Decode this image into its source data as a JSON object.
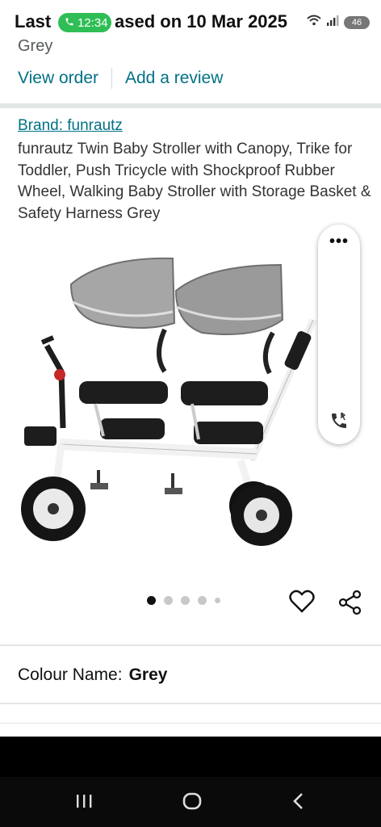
{
  "status": {
    "label_start": "Last",
    "call_time": "12:34",
    "label_end": "ased on 10 Mar 2025",
    "battery": "46"
  },
  "order": {
    "color": "Grey",
    "view_order": "View order",
    "add_review": "Add a review"
  },
  "product": {
    "brand": "Brand: funrautz",
    "title": "funrautz Twin Baby Stroller with Canopy, Trike for Toddler, Push Tricycle with Shockproof Rubber Wheel, Walking Baby Stroller with Storage Basket & Safety Harness Grey"
  },
  "carousel": {
    "total": 5,
    "active": 0
  },
  "colour": {
    "label": "Colour Name:",
    "value": "Grey"
  },
  "colors": {
    "link": "#007185",
    "canopy": "#9a9a9a",
    "frame": "#f2f2f2",
    "seat": "#1d1d1d",
    "call_green": "#2fbe55"
  },
  "icons": [
    "call-icon",
    "wifi-icon",
    "signal-icon",
    "battery-icon",
    "more-icon",
    "bluetooth-phone-icon",
    "heart-icon",
    "share-icon",
    "recents-icon",
    "home-icon",
    "back-icon"
  ]
}
